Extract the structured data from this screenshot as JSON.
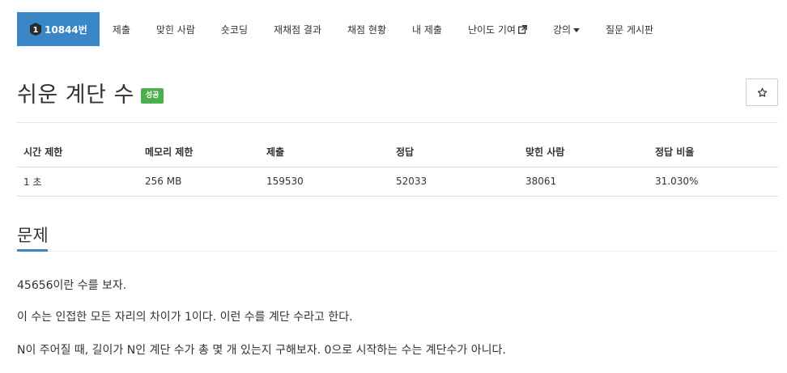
{
  "nav": {
    "problem_tab": {
      "label": "10844번",
      "tier": "1"
    },
    "tabs": [
      {
        "label": "제출"
      },
      {
        "label": "맞힌 사람"
      },
      {
        "label": "숏코딩"
      },
      {
        "label": "재채점 결과"
      },
      {
        "label": "채점 현황"
      },
      {
        "label": "내 제출"
      },
      {
        "label": "난이도 기여"
      },
      {
        "label": "강의"
      },
      {
        "label": "질문 게시판"
      }
    ]
  },
  "problem": {
    "title": "쉬운 계단 수",
    "status_badge": "성공"
  },
  "info": {
    "headers": [
      "시간 제한",
      "메모리 제한",
      "제출",
      "정답",
      "맞힌 사람",
      "정답 비율"
    ],
    "values": [
      "1 초",
      "256 MB",
      "159530",
      "52033",
      "38061",
      "31.030%"
    ]
  },
  "section": {
    "title": "문제"
  },
  "description": [
    "45656이란 수를 보자.",
    "이 수는 인접한 모든 자리의 차이가 1이다. 이런 수를 계단 수라고 한다.",
    "N이 주어질 때, 길이가 N인 계단 수가 총 몇 개 있는지 구해보자. 0으로 시작하는 수는 계단수가 아니다."
  ],
  "colors": {
    "active_tab": "#3a87c8",
    "success_badge": "#4cae4c",
    "text": "#333333"
  }
}
